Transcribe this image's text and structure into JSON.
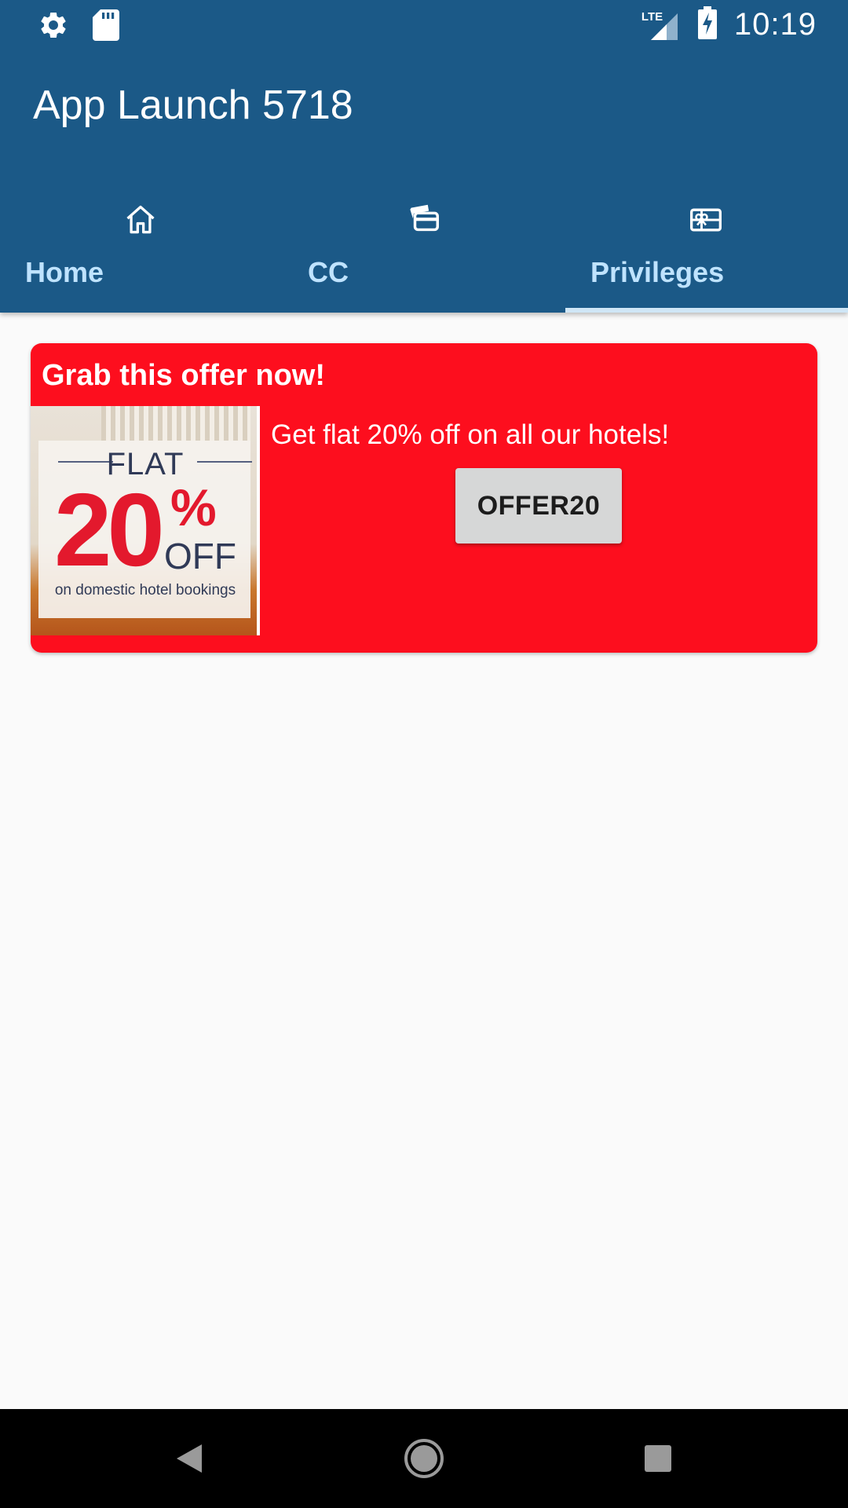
{
  "status_bar": {
    "time": "10:19",
    "network_label": "LTE",
    "icons": [
      "settings-icon",
      "sd-card-icon",
      "lte-signal-icon",
      "battery-charging-icon"
    ]
  },
  "app_bar": {
    "title": "App Launch 5718"
  },
  "tabs": [
    {
      "label": "Home",
      "icon": "home-icon",
      "selected": false
    },
    {
      "label": "CC",
      "icon": "credit-cards-icon",
      "selected": false
    },
    {
      "label": "Privileges",
      "icon": "gift-card-icon",
      "selected": true
    }
  ],
  "offer_card": {
    "title": "Grab this offer now!",
    "description": "Get flat 20% off on all our hotels!",
    "button_label": "OFFER20",
    "image": {
      "flat_text": "FLAT",
      "percent_number": "20",
      "percent_sign": "%",
      "off_text": "OFF",
      "caption": "on domestic hotel bookings"
    }
  },
  "navigation_bar": {
    "buttons": [
      "back-icon",
      "home-circle-icon",
      "recents-icon"
    ]
  },
  "colors": {
    "primary": "#1b5987",
    "tab_text": "#bfe3ff",
    "card_background": "#fd0e1e",
    "button_background": "#d6d7d7",
    "page_background": "#fafafa"
  }
}
